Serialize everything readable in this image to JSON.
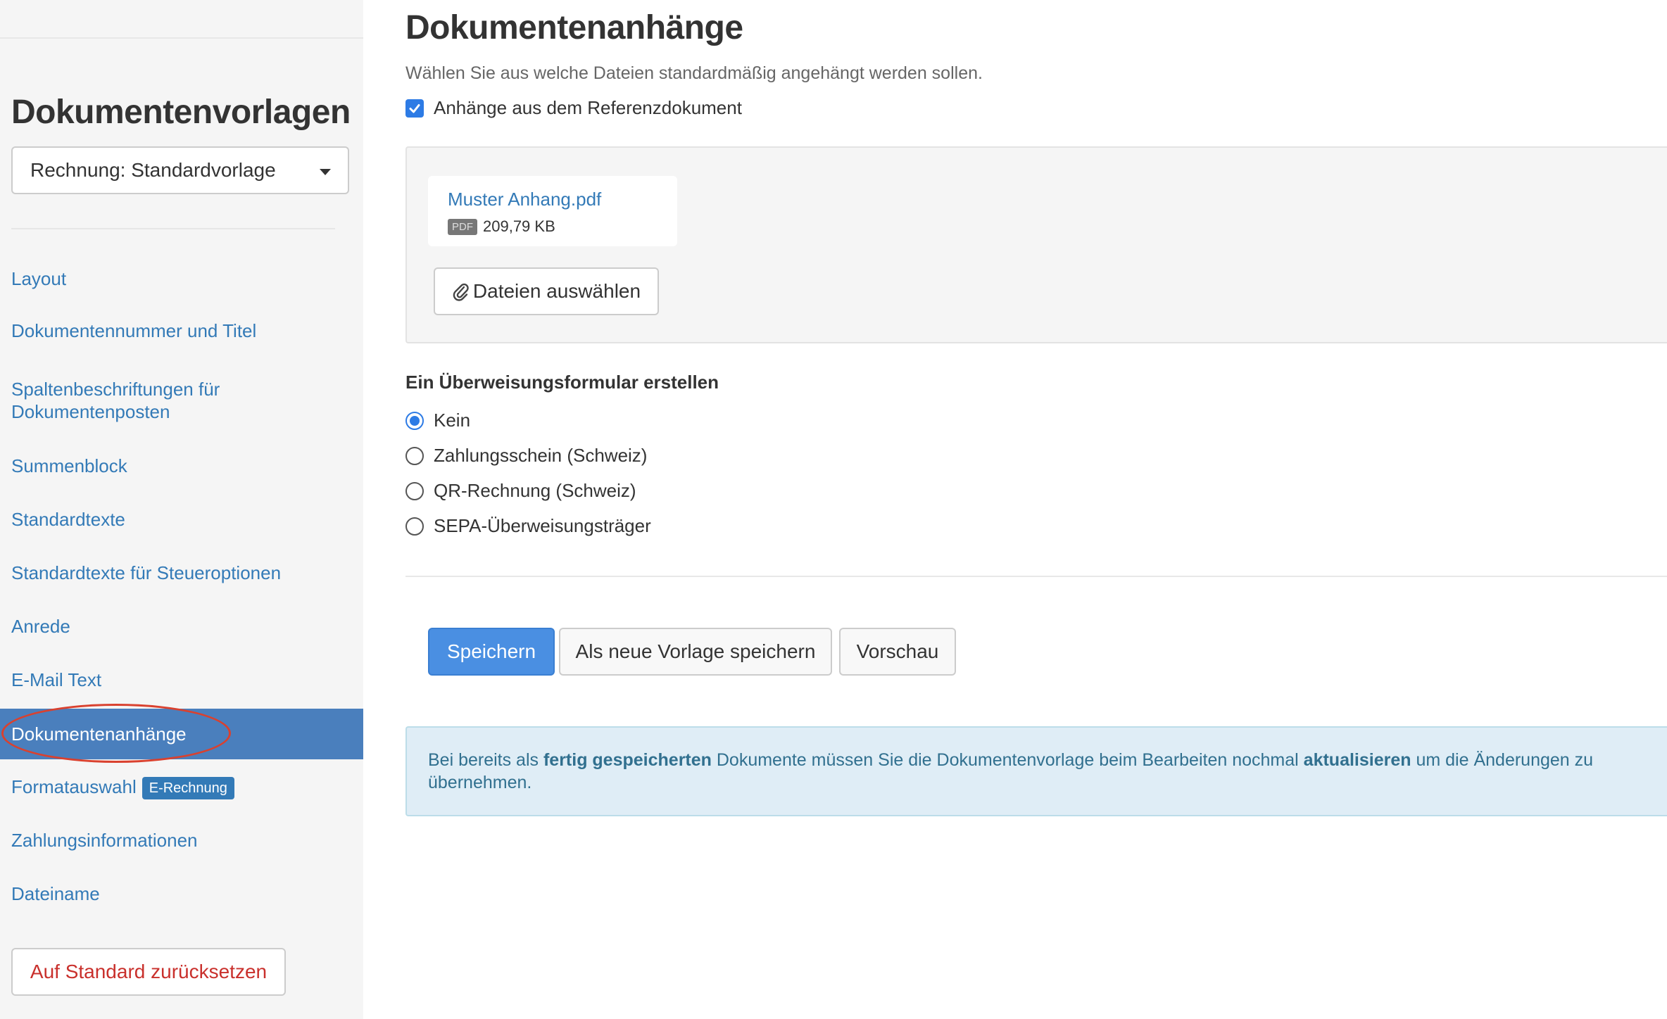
{
  "sidebar": {
    "title": "Dokumentenvorlagen",
    "template_select": "Rechnung: Standardvorlage",
    "items": [
      {
        "label": "Layout"
      },
      {
        "label": "Dokumentennummer und Titel"
      },
      {
        "label": "Spaltenbeschriftungen für Dokumentenposten"
      },
      {
        "label": "Summenblock"
      },
      {
        "label": "Standardtexte"
      },
      {
        "label": "Standardtexte für Steueroptionen"
      },
      {
        "label": "Anrede"
      },
      {
        "label": "E-Mail Text"
      },
      {
        "label": "Dokumentenanhänge",
        "active": true
      },
      {
        "label": "Formatauswahl",
        "badge": "E-Rechnung"
      },
      {
        "label": "Zahlungsinformationen"
      },
      {
        "label": "Dateiname"
      }
    ],
    "reset_label": "Auf Standard zurücksetzen"
  },
  "main": {
    "title": "Dokumentenanhänge",
    "subtitle": "Wählen Sie aus welche Dateien standardmäßig angehängt werden sollen.",
    "checkbox_label": "Anhänge aus dem Referenzdokument",
    "checkbox_checked": true,
    "attachment": {
      "filename": "Muster Anhang.pdf",
      "type": "PDF",
      "size": "209,79 KB"
    },
    "choose_files_label": "Dateien auswählen",
    "transfer_form": {
      "title": "Ein Überweisungsformular erstellen",
      "options": [
        {
          "label": "Kein",
          "checked": true
        },
        {
          "label": "Zahlungsschein (Schweiz)",
          "checked": false
        },
        {
          "label": "QR-Rechnung (Schweiz)",
          "checked": false
        },
        {
          "label": "SEPA-Überweisungsträger",
          "checked": false
        }
      ]
    },
    "buttons": {
      "save": "Speichern",
      "save_as_new": "Als neue Vorlage speichern",
      "preview": "Vorschau"
    },
    "info": {
      "part1": "Bei bereits als ",
      "bold1": "fertig gespeicherten",
      "part2": " Dokumente müssen Sie die Dokumentenvorlage beim Bearbeiten nochmal ",
      "bold2": "aktualisieren",
      "part3": " um die Änderungen zu übernehmen."
    }
  },
  "colors": {
    "link": "#337ab7",
    "active_nav": "#4a7fbd",
    "primary": "#4a8fe2",
    "danger": "#c9302c",
    "annotation_ring": "#d9412f"
  }
}
